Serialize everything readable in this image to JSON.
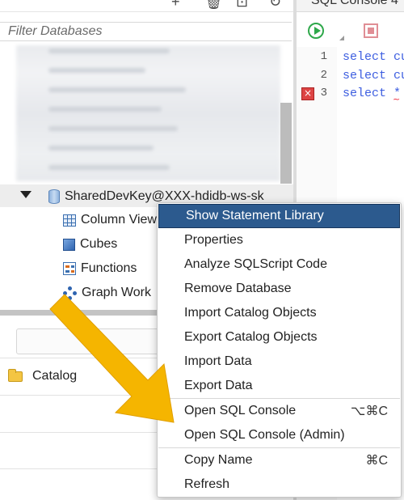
{
  "left_panel": {
    "filter_placeholder": "Filter Databases",
    "tree": {
      "database": "SharedDevKey@XXX-hdidb-ws-sk",
      "children": [
        {
          "label": "Column View",
          "icon": "column-view-icon"
        },
        {
          "label": "Cubes",
          "icon": "cubes-icon"
        },
        {
          "label": "Functions",
          "icon": "functions-icon"
        },
        {
          "label": "Graph Work",
          "icon": "graph-workspace-icon"
        }
      ]
    },
    "catalog": {
      "label": "Catalog",
      "icon": "folder-icon"
    }
  },
  "editor": {
    "tab_title": "SQL Console 4",
    "line_numbers": [
      "1",
      "2",
      "3"
    ],
    "code_lines": [
      "select cu",
      "select cu",
      "select *"
    ],
    "error_line": "3",
    "colors": {
      "keyword": "#3d5ee0",
      "run": "#2ea84a",
      "stop": "#e08e95",
      "error": "#dd4444"
    }
  },
  "context_menu": {
    "items": [
      {
        "label": "Show Statement Library",
        "highlighted": true
      },
      {
        "label": "Properties"
      },
      {
        "label": "Analyze SQLScript Code"
      },
      {
        "label": "Remove Database"
      },
      {
        "label": "Import Catalog Objects"
      },
      {
        "label": "Export Catalog Objects"
      },
      {
        "label": "Import Data"
      },
      {
        "label": "Export Data"
      },
      {
        "label": "Open SQL Console",
        "shortcut": "⌥⌘C"
      },
      {
        "label": "Open SQL Console (Admin)"
      },
      {
        "label": "Copy Name",
        "shortcut": "⌘C"
      },
      {
        "label": "Refresh"
      }
    ],
    "highlight_color": "#2c5a8e"
  },
  "annotation": {
    "arrow_color": "#f5b500",
    "target": "Open SQL Console (Admin)"
  }
}
